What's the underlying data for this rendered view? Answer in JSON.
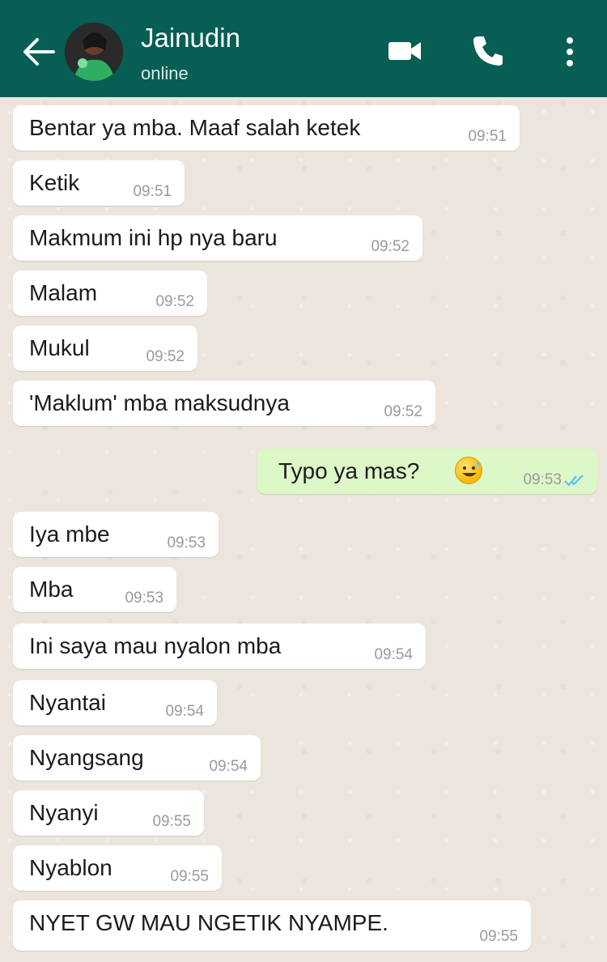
{
  "header": {
    "contact_name": "Jainudin",
    "status": "online",
    "colors": {
      "bar": "#075e54",
      "text": "#ffffff"
    },
    "icons": [
      "back-arrow-icon",
      "video-call-icon",
      "phone-icon",
      "more-vert-icon"
    ]
  },
  "messages": [
    {
      "text": "Bentar ya mba. Maaf salah ketek",
      "time": "09:51",
      "direction": "incoming"
    },
    {
      "text": "Ketik",
      "time": "09:51",
      "direction": "incoming"
    },
    {
      "text": "Makmum ini hp nya baru",
      "time": "09:52",
      "direction": "incoming"
    },
    {
      "text": "Malam",
      "time": "09:52",
      "direction": "incoming"
    },
    {
      "text": "Mukul",
      "time": "09:52",
      "direction": "incoming"
    },
    {
      "text": "'Maklum' mba maksudnya",
      "time": "09:52",
      "direction": "incoming"
    },
    {
      "text": "Typo ya mas?",
      "time": "09:53",
      "direction": "outgoing",
      "emoji": "grinning-sweat-emoji",
      "status": "read"
    },
    {
      "text": "Iya mbe",
      "time": "09:53",
      "direction": "incoming"
    },
    {
      "text": "Mba",
      "time": "09:53",
      "direction": "incoming"
    },
    {
      "text": "Ini saya mau nyalon mba",
      "time": "09:54",
      "direction": "incoming"
    },
    {
      "text": "Nyantai",
      "time": "09:54",
      "direction": "incoming"
    },
    {
      "text": "Nyangsang",
      "time": "09:54",
      "direction": "incoming"
    },
    {
      "text": "Nyanyi",
      "time": "09:55",
      "direction": "incoming"
    },
    {
      "text": "Nyablon",
      "time": "09:55",
      "direction": "incoming"
    },
    {
      "text": "NYET GW MAU NGETIK NYAMPE.",
      "time": "09:55",
      "direction": "incoming"
    }
  ],
  "colors": {
    "incoming_bubble": "#ffffff",
    "outgoing_bubble": "#dcf8c6",
    "chat_background": "#ece5dd",
    "read_ticks": "#4fc3f7"
  }
}
